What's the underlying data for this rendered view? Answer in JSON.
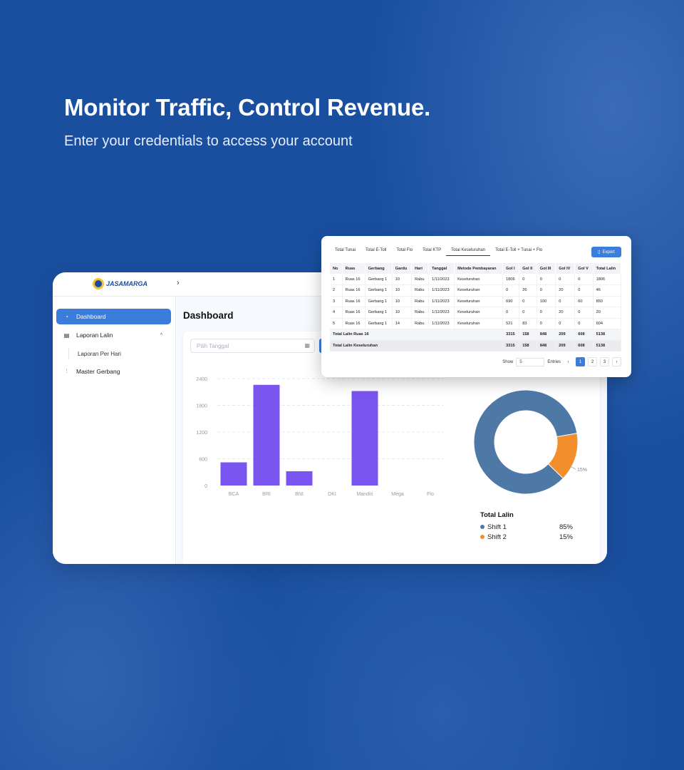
{
  "hero": {
    "title": "Monitor Traffic, Control Revenue.",
    "subtitle": "Enter your credentials to access your account"
  },
  "app": {
    "logo_text": "JASAMARGA",
    "page_title": "Dashboard",
    "date_placeholder": "Pilih Tanggal",
    "sidebar": {
      "items": [
        {
          "label": "Dashboard",
          "icon": "gauge-icon",
          "active": true
        },
        {
          "label": "Laporan Lalin",
          "icon": "document-icon",
          "expanded": true
        },
        {
          "label": "Laporan Per Hari",
          "sub": true
        },
        {
          "label": "Master Gerbang",
          "icon": "sliders-icon"
        }
      ]
    },
    "donut_legend": {
      "title": "Total Lalin",
      "items": [
        {
          "label": "Shift 1",
          "pct": "85%",
          "color": "#4e79a7"
        },
        {
          "label": "Shift 2",
          "pct": "15%",
          "color": "#f28e2b"
        }
      ]
    }
  },
  "table_card": {
    "tabs": [
      "Total Tunai",
      "Total E-Toll",
      "Total Flo",
      "Total KTP",
      "Total Keseluruhan",
      "Total E-Toll + Tunai + Flo"
    ],
    "active_tab": 4,
    "export_label": "Export",
    "headers": [
      "No",
      "Ruas",
      "Gerbang",
      "Gardu",
      "Hari",
      "Tanggal",
      "Metode Pembayaran",
      "Gol I",
      "Gol II",
      "Gol III",
      "Gol IV",
      "Gol V",
      "Total Lalin"
    ],
    "rows": [
      [
        "1",
        "Ruas 16",
        "Gerbang 1",
        "10",
        "Rabu",
        "1/11/2023",
        "Keseluruhan",
        "1806",
        "0",
        "0",
        "0",
        "0",
        "1806"
      ],
      [
        "2",
        "Ruas 16",
        "Gerbang 1",
        "10",
        "Rabu",
        "1/11/2023",
        "Keseluruhan",
        "0",
        "26",
        "0",
        "20",
        "0",
        "46"
      ],
      [
        "3",
        "Ruas 16",
        "Gerbang 1",
        "10",
        "Rabu",
        "1/11/2023",
        "Keseluruhan",
        "690",
        "0",
        "100",
        "0",
        "60",
        "850"
      ],
      [
        "4",
        "Ruas 16",
        "Gerbang 1",
        "10",
        "Rabu",
        "1/11/2023",
        "Keseluruhan",
        "0",
        "0",
        "0",
        "20",
        "0",
        "20"
      ],
      [
        "5",
        "Ruas 16",
        "Gerbang 1",
        "14",
        "Rabu",
        "1/11/2023",
        "Keseluruhan",
        "521",
        "83",
        "0",
        "0",
        "0",
        "604"
      ]
    ],
    "total_ruas": {
      "label": "Total Lalin Ruas 16",
      "values": [
        "3315",
        "158",
        "848",
        "209",
        "608",
        "5138"
      ]
    },
    "total_all": {
      "label": "Total Lalin Keseluruhan",
      "values": [
        "3315",
        "158",
        "848",
        "209",
        "608",
        "5138"
      ]
    },
    "pager": {
      "show_label": "Show",
      "show_value": "5",
      "entries_label": "Entries",
      "pages": [
        "1",
        "2",
        "3"
      ],
      "current": 0,
      "prev": "‹",
      "next": "›"
    }
  },
  "chart_data": [
    {
      "type": "bar",
      "categories": [
        "BCA",
        "BRI",
        "BNI",
        "DKI",
        "Mandiri",
        "Mega",
        "Flo"
      ],
      "values": [
        520,
        2260,
        320,
        0,
        2120,
        0,
        0
      ],
      "yticks": [
        0,
        600,
        1200,
        1800,
        2400
      ],
      "ylim": [
        0,
        2400
      ],
      "color": "#7b55f0",
      "grid": true
    },
    {
      "type": "pie",
      "donut": true,
      "labels": [
        "Shift 1",
        "Shift 2"
      ],
      "values": [
        85,
        15
      ],
      "colors": [
        "#4e79a7",
        "#f28e2b"
      ],
      "data_labels": [
        "85%",
        "15%"
      ]
    }
  ]
}
